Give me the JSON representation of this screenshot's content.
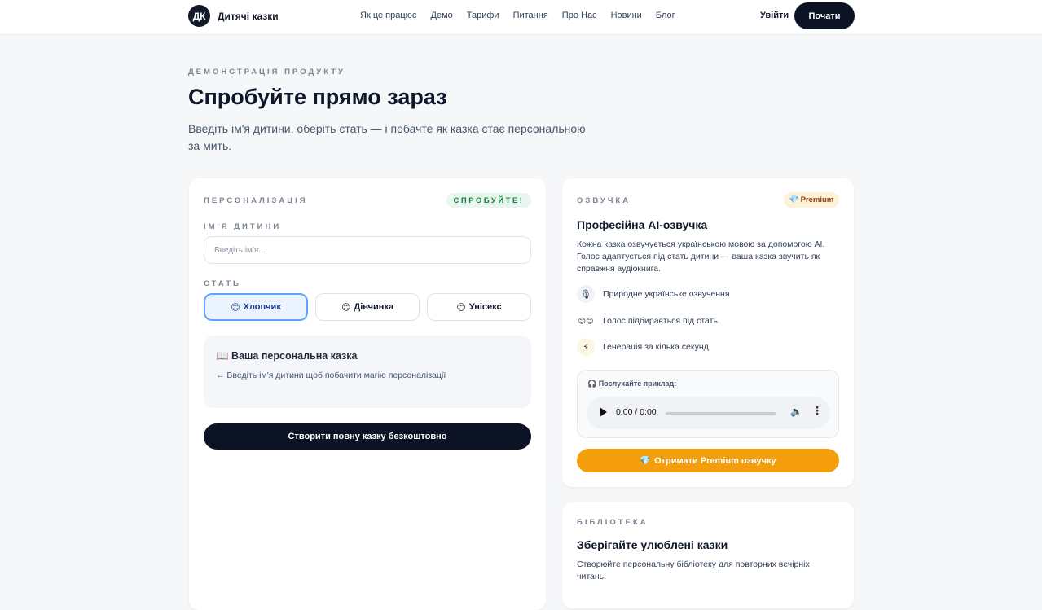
{
  "nav": {
    "logo_badge": "ДК",
    "brand": "Дитячі казки",
    "links": [
      "Як це працює",
      "Демо",
      "Тарифи",
      "Питання",
      "Про Нас",
      "Новини",
      "Блог"
    ],
    "login": "Увійти",
    "start": "Почати"
  },
  "hero": {
    "eyebrow": "ДЕМОНСТРАЦІЯ ПРОДУКТУ",
    "title": "Спробуйте прямо зараз",
    "subtitle": "Введіть ім'я дитини, оберіть стать — і побачте як казка стає персональною за мить."
  },
  "personalization": {
    "label": "ПЕРСОНАЛІЗАЦІЯ",
    "badge": "СПРОБУЙТЕ!",
    "name_label": "ІМ'Я ДИТИНИ",
    "name_placeholder": "Введіть ім'я...",
    "name_value": "",
    "gender_label": "СТАТЬ",
    "genders": [
      {
        "emoji": "😊",
        "label": "Хлопчик",
        "active": true
      },
      {
        "emoji": "😊",
        "label": "Дівчинка",
        "active": false
      },
      {
        "emoji": "😊",
        "label": "Унісекс",
        "active": false
      }
    ],
    "preview_title": "📖 Ваша персональна казка",
    "preview_hint": "← Введіть ім'я дитини щоб побачити магію персоналізації",
    "create_button": "Створити повну казку безкоштовно"
  },
  "voice": {
    "label": "ОЗВУЧКА",
    "badge_icon": "💎",
    "badge": "Premium",
    "title": "Професійна AI-озвучка",
    "description": "Кожна казка озвучується українською мовою за допомогою AI. Голос адаптується під стать дитини — ваша казка звучить як справжня аудіокнига.",
    "features": [
      {
        "icon": "🎙",
        "text": "Природне українське озвучення"
      },
      {
        "icon": "😊😊",
        "text": "Голос підбирається під стать"
      },
      {
        "icon": "⚡",
        "text": "Генерація за кілька секунд"
      }
    ],
    "sample_label": "🎧 Послухайте приклад:",
    "player_time": "0:00 / 0:00",
    "premium_button_icon": "💎",
    "premium_button": "Отримати Premium озвучку"
  },
  "library": {
    "label": "БІБЛІОТЕКА",
    "title": "Зберігайте улюблені казки",
    "description": "Створюйте персональну бібліотеку для повторних вечірніх читань."
  }
}
